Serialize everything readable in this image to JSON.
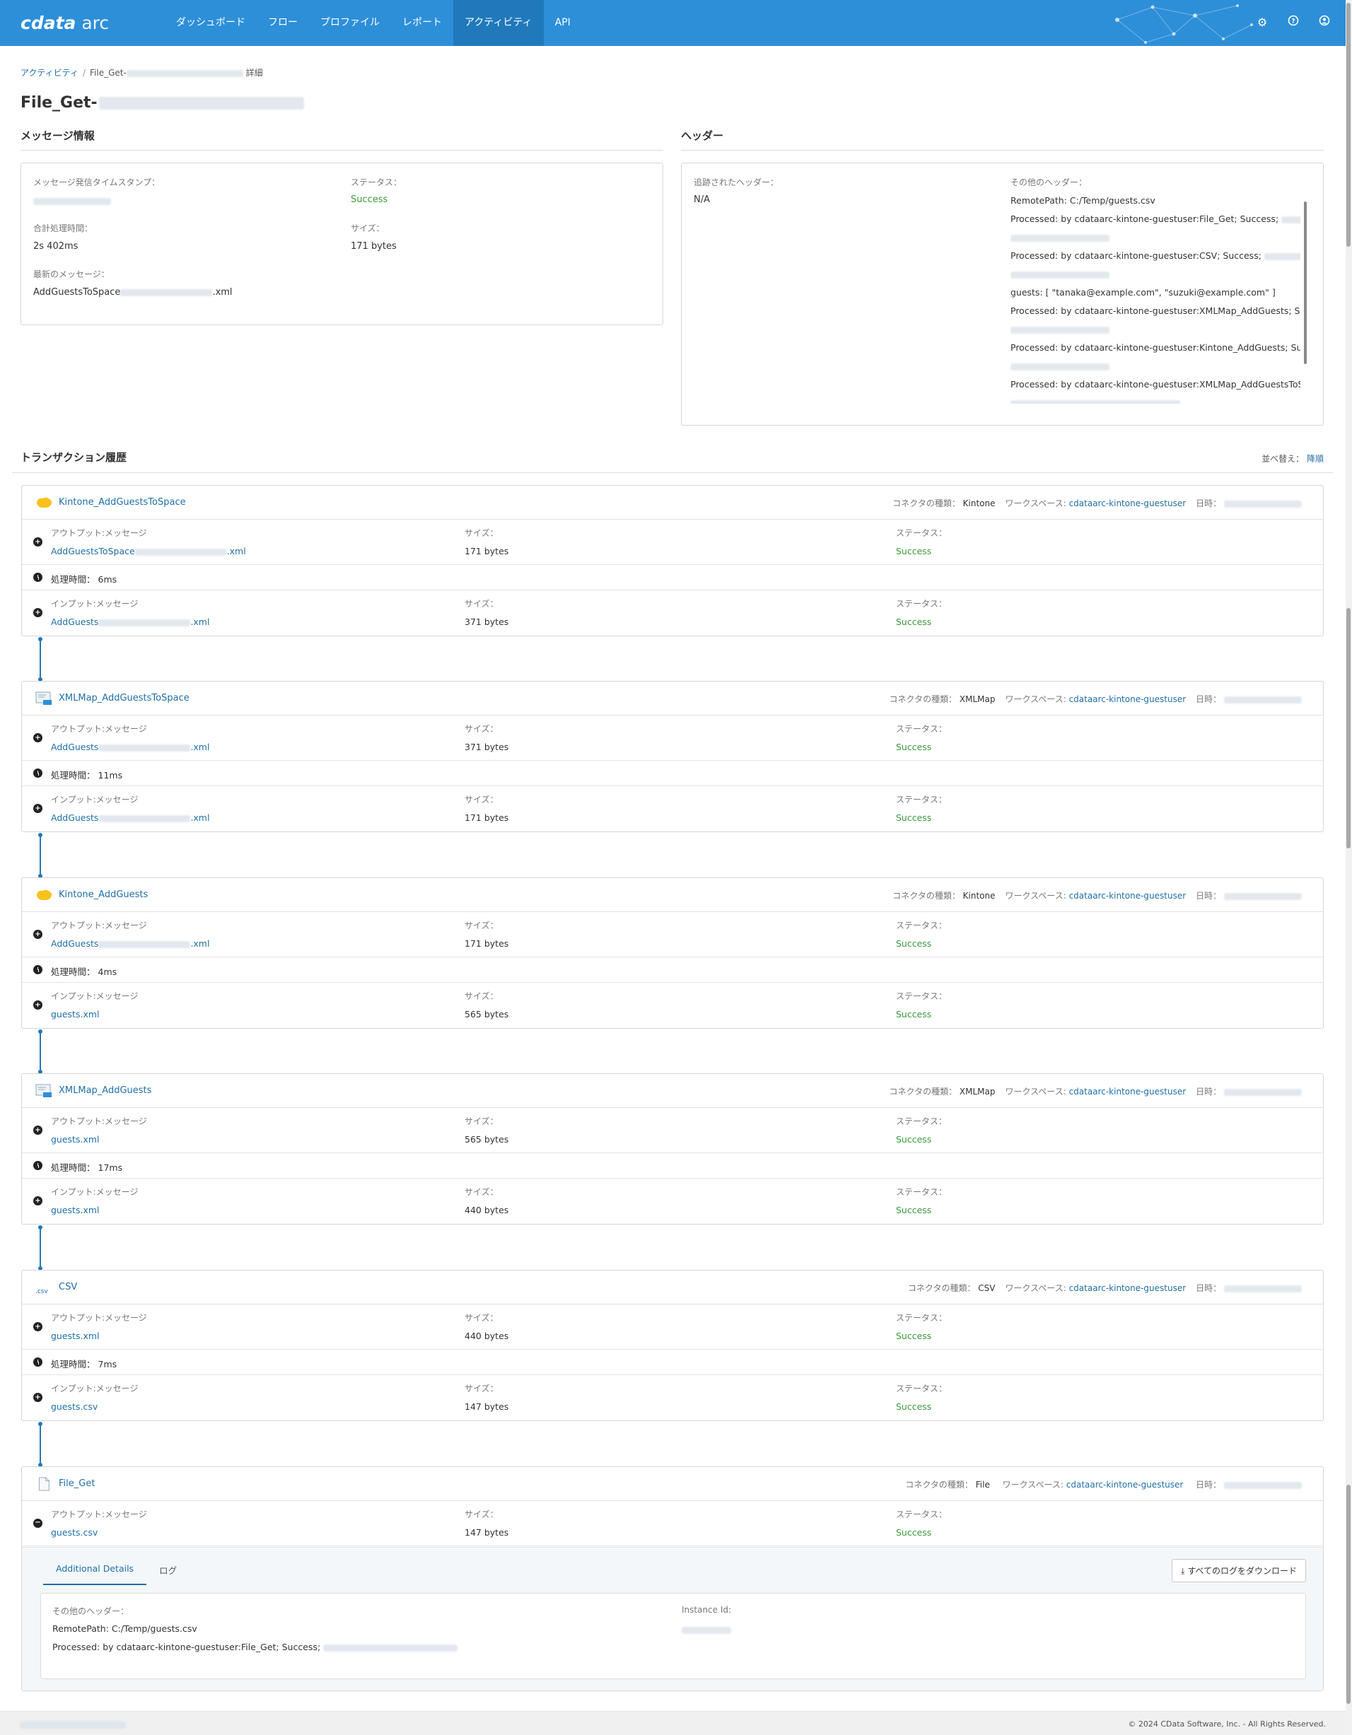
{
  "brand": {
    "logo_bold": "cdata",
    "logo_light": "arc"
  },
  "nav": [
    {
      "label": "ダッシュボード"
    },
    {
      "label": "フロー"
    },
    {
      "label": "プロファイル"
    },
    {
      "label": "レポート"
    },
    {
      "label": "アクティビティ",
      "active": true
    },
    {
      "label": "API"
    }
  ],
  "breadcrumb": {
    "root": "アクティビティ",
    "prefix": "File_Get-",
    "suffix": "詳細"
  },
  "page_title": "File_Get-",
  "message_info": {
    "section_title": "メッセージ情報",
    "timestamp_label": "メッセージ発信タイムスタンプ：",
    "status_label": "ステータス：",
    "status_value": "Success",
    "total_time_label": "合計処理時間：",
    "total_time_value": "2s 402ms",
    "size_label": "サイズ：",
    "size_value": "171 bytes",
    "latest_label": "最新のメッセージ：",
    "latest_prefix": "AddGuestsToSpace",
    "latest_suffix": ".xml"
  },
  "headers": {
    "section_title": "ヘッダー",
    "added_label": "追跡されたヘッダー：",
    "added_value": "N/A",
    "other_label": "その他のヘッダー：",
    "other_lines": [
      "RemotePath: C:/Temp/guests.csv",
      "Processed: by cdataarc-kintone-guestuser:File_Get; Success;",
      "",
      "Processed: by cdataarc-kintone-guestuser:CSV; Success;",
      "",
      "guests: [ \"tanaka@example.com\", \"suzuki@example.com\" ]",
      "Processed: by cdataarc-kintone-guestuser:XMLMap_AddGuests; Success;",
      "",
      "Processed: by cdataarc-kintone-guestuser:Kintone_AddGuests; Success;",
      "",
      "Processed: by cdataarc-kintone-guestuser:XMLMap_AddGuestsToSpace;",
      ""
    ]
  },
  "transactions": {
    "section_title": "トランザクション履歴",
    "sort_label": "並べ替え：",
    "sort_value": "降順",
    "labels": {
      "connector_type": "コネクタの種類：",
      "workspace": "ワークスペース:",
      "datetime": "日時：",
      "output": "アウトプット:メッセージ",
      "input": "インプット:メッセージ",
      "size": "サイズ：",
      "status": "ステータス：",
      "time": "処理時間："
    },
    "items": [
      {
        "name": "Kintone_AddGuestsToSpace",
        "icon": "kintone-icon",
        "type": "Kintone",
        "workspace": "cdataarc-kintone-guestuser",
        "out_prefix": "AddGuestsToSpace",
        "out_suffix": ".xml",
        "out_size": "171 bytes",
        "out_status": "Success",
        "time": "6ms",
        "in_prefix": "AddGuests",
        "in_suffix": ".xml",
        "in_size": "371 bytes",
        "in_status": "Success"
      },
      {
        "name": "XMLMap_AddGuestsToSpace",
        "icon": "xmlmap-icon",
        "type": "XMLMap",
        "workspace": "cdataarc-kintone-guestuser",
        "out_prefix": "AddGuests",
        "out_suffix": ".xml",
        "out_size": "371 bytes",
        "out_status": "Success",
        "time": "11ms",
        "in_prefix": "AddGuests",
        "in_suffix": ".xml",
        "in_size": "171 bytes",
        "in_status": "Success"
      },
      {
        "name": "Kintone_AddGuests",
        "icon": "kintone-icon",
        "type": "Kintone",
        "workspace": "cdataarc-kintone-guestuser",
        "out_prefix": "AddGuests",
        "out_suffix": ".xml",
        "out_size": "171 bytes",
        "out_status": "Success",
        "time": "4ms",
        "in_prefix": "guests.xml",
        "in_suffix": "",
        "in_size": "565 bytes",
        "in_status": "Success"
      },
      {
        "name": "XMLMap_AddGuests",
        "icon": "xmlmap-icon",
        "type": "XMLMap",
        "workspace": "cdataarc-kintone-guestuser",
        "out_prefix": "guests.xml",
        "out_suffix": "",
        "out_size": "565 bytes",
        "out_status": "Success",
        "time": "17ms",
        "in_prefix": "guests.xml",
        "in_suffix": "",
        "in_size": "440 bytes",
        "in_status": "Success"
      },
      {
        "name": "CSV",
        "icon": "csv-icon",
        "type": "CSV",
        "workspace": "cdataarc-kintone-guestuser",
        "out_prefix": "guests.xml",
        "out_suffix": "",
        "out_size": "440 bytes",
        "out_status": "Success",
        "time": "7ms",
        "in_prefix": "guests.csv",
        "in_suffix": "",
        "in_size": "147 bytes",
        "in_status": "Success"
      }
    ],
    "last": {
      "name": "File_Get",
      "type": "File",
      "workspace": "cdataarc-kintone-guestuser",
      "out_prefix": "guests.csv",
      "out_size": "147 bytes",
      "out_status": "Success",
      "tab_details": "Additional Details",
      "tab_log": "ログ",
      "download_label": "すべてのログをダウンロード",
      "other_headers_label": "その他のヘッダー：",
      "remote_path": "RemotePath: C:/Temp/guests.csv",
      "processed": "Processed: by cdataarc-kintone-guestuser:File_Get; Success;",
      "instance_label": "Instance Id:"
    }
  },
  "footer": {
    "copyright": "© 2024 CData Software, Inc. - All Rights Reserved."
  },
  "colors": {
    "topbar": "#2d8fd8",
    "nav_active": "#2079bb",
    "link": "#1f6fa8",
    "success": "#3a9a3a",
    "connector": "#2379b6"
  }
}
